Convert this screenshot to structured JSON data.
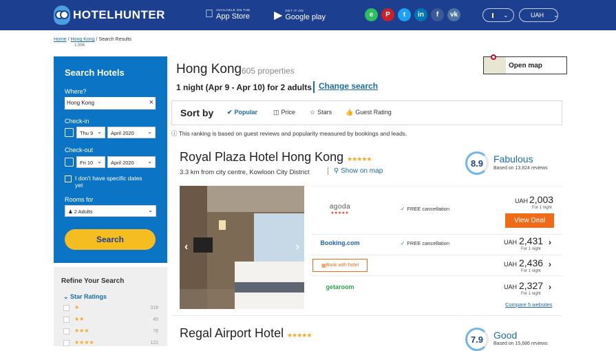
{
  "header": {
    "logo_text": "HOTELHUNTER",
    "appstore_small": "AVAILABLE ON THE",
    "appstore_big": "App Store",
    "googleplay_small": "GET IT ON",
    "googleplay_big": "Google play",
    "socials": [
      {
        "icon": "evernote-icon",
        "glyph": "e",
        "color": "#2dbe60"
      },
      {
        "icon": "pinterest-icon",
        "glyph": "P",
        "color": "#cb2027"
      },
      {
        "icon": "twitter-icon",
        "glyph": "t",
        "color": "#1da1f2"
      },
      {
        "icon": "linkedin-icon",
        "glyph": "in",
        "color": "#0077b5"
      },
      {
        "icon": "facebook-icon",
        "glyph": "f",
        "color": "#3b5998"
      },
      {
        "icon": "vk-icon",
        "glyph": "vk",
        "color": "#4c75a3"
      }
    ],
    "currency": "UAH"
  },
  "breadcrumb": {
    "home": "Home",
    "city": "Hong Kong",
    "sep": "/",
    "current": "Search Results",
    "count": "1,556"
  },
  "sidebar": {
    "title": "Search Hotels",
    "where_label": "Where?",
    "where_value": "Hong Kong",
    "checkin_label": "Check-in",
    "checkin_day": "Thu 9",
    "checkin_month": "April 2020",
    "checkout_label": "Check-out",
    "checkout_day": "Fri 10",
    "checkout_month": "April 2020",
    "nodates_label": "I don't have specific dates yet",
    "rooms_label": "Rooms for",
    "rooms_value": "2 Adults",
    "search_button": "Search"
  },
  "refine": {
    "title": "Refine Your Search",
    "star_ratings_label": "Star Ratings",
    "rows": [
      {
        "stars": "★",
        "count": "318"
      },
      {
        "stars": "★★",
        "count": "45"
      },
      {
        "stars": "★★★",
        "count": "76"
      },
      {
        "stars": "★★★★",
        "count": "122"
      }
    ]
  },
  "main": {
    "city": "Hong Kong",
    "properties": "605 properties",
    "open_map": "Open map",
    "dates_summary": "1 night (Apr 9 - Apr 10) for 2 adults",
    "change_search": "Change search",
    "sort_title": "Sort by",
    "sort_options": [
      "Popular",
      "Price",
      "Stars",
      "Guest Rating"
    ],
    "ranking_note": "This ranking is based on guest reviews and popularity measured by bookings and leads."
  },
  "hotels": [
    {
      "name": "Royal Plaza Hotel Hong Kong",
      "stars": "★★★★★",
      "location": "3.3 km from city centre, Kowloon City District",
      "show_on_map": "Show on map",
      "score": "8.9",
      "verdict": "Fabulous",
      "reviews": "Based on 13,824 reviews",
      "deals": [
        {
          "provider": "agoda",
          "free": "FREE cancellation",
          "currency": "UAH",
          "price": "2,003",
          "per": "For 1 night",
          "cta": "View Deal"
        },
        {
          "provider": "Booking.com",
          "free": "FREE cancellation",
          "currency": "UAH",
          "price": "2,431",
          "per": "For 1 night"
        },
        {
          "provider": "Book with hotel",
          "free": "",
          "currency": "UAH",
          "price": "2,436",
          "per": "For 1 night"
        },
        {
          "provider": "getaroom",
          "free": "",
          "currency": "UAH",
          "price": "2,327",
          "per": "For 1 night"
        }
      ],
      "compare": "Compare 5 websites"
    },
    {
      "name": "Regal Airport Hotel",
      "stars": "★★★★★",
      "score": "7.9",
      "verdict": "Good",
      "reviews": "Based on 15,686 reviews"
    }
  ]
}
